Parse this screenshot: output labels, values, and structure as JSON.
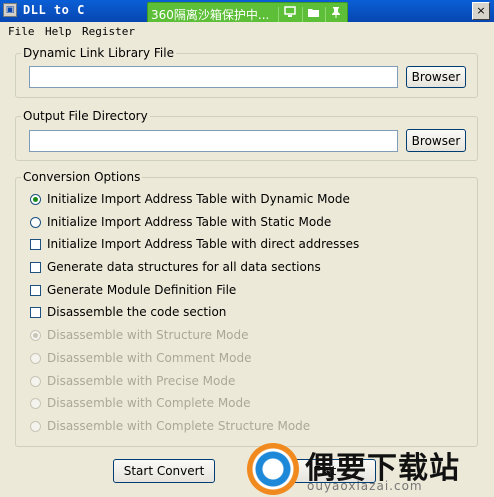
{
  "window": {
    "title": "DLL to C",
    "close_label": "×"
  },
  "sandbox": {
    "text": "360隔离沙箱保护中...",
    "icons": [
      "monitor-icon",
      "folder-icon",
      "pin-icon"
    ]
  },
  "menu": [
    "File",
    "Help",
    "Register"
  ],
  "dll_group": {
    "label": "Dynamic Link Library File",
    "input_value": "",
    "browse_label": "Browser"
  },
  "output_group": {
    "label": "Output File Directory",
    "input_value": "",
    "browse_label": "Browser"
  },
  "options_group": {
    "label": "Conversion Options",
    "options": [
      {
        "label": "Initialize Import Address Table with Dynamic Mode",
        "kind": "radio",
        "checked": true,
        "enabled": true
      },
      {
        "label": "Initialize Import Address Table with Static Mode",
        "kind": "radio",
        "checked": false,
        "enabled": true
      },
      {
        "label": "Initialize Import Address Table with direct addresses",
        "kind": "checkbox",
        "checked": false,
        "enabled": true
      },
      {
        "label": "Generate data structures for all data sections",
        "kind": "checkbox",
        "checked": false,
        "enabled": true
      },
      {
        "label": "Generate Module Definition File",
        "kind": "checkbox",
        "checked": false,
        "enabled": true
      },
      {
        "label": "Disassemble the code section",
        "kind": "checkbox",
        "checked": false,
        "enabled": true
      },
      {
        "label": "Disassemble with Structure Mode",
        "kind": "radio",
        "checked": true,
        "enabled": false
      },
      {
        "label": "Disassemble with Comment Mode",
        "kind": "radio",
        "checked": false,
        "enabled": false
      },
      {
        "label": "Disassemble with Precise Mode",
        "kind": "radio",
        "checked": false,
        "enabled": false
      },
      {
        "label": "Disassemble with Complete Mode",
        "kind": "radio",
        "checked": false,
        "enabled": false
      },
      {
        "label": "Disassemble with Complete Structure Mode",
        "kind": "radio",
        "checked": false,
        "enabled": false
      }
    ]
  },
  "actions": {
    "start_label": "Start Convert",
    "exit_label": "Exit"
  },
  "watermark": {
    "cn": "偶要下载站",
    "url": "ouyaoxiazai.com"
  },
  "colors": {
    "titlebar": "#0846b1",
    "sandbox": "#5cbf37",
    "face": "#ece9d8",
    "disabled_text": "#aca899"
  }
}
